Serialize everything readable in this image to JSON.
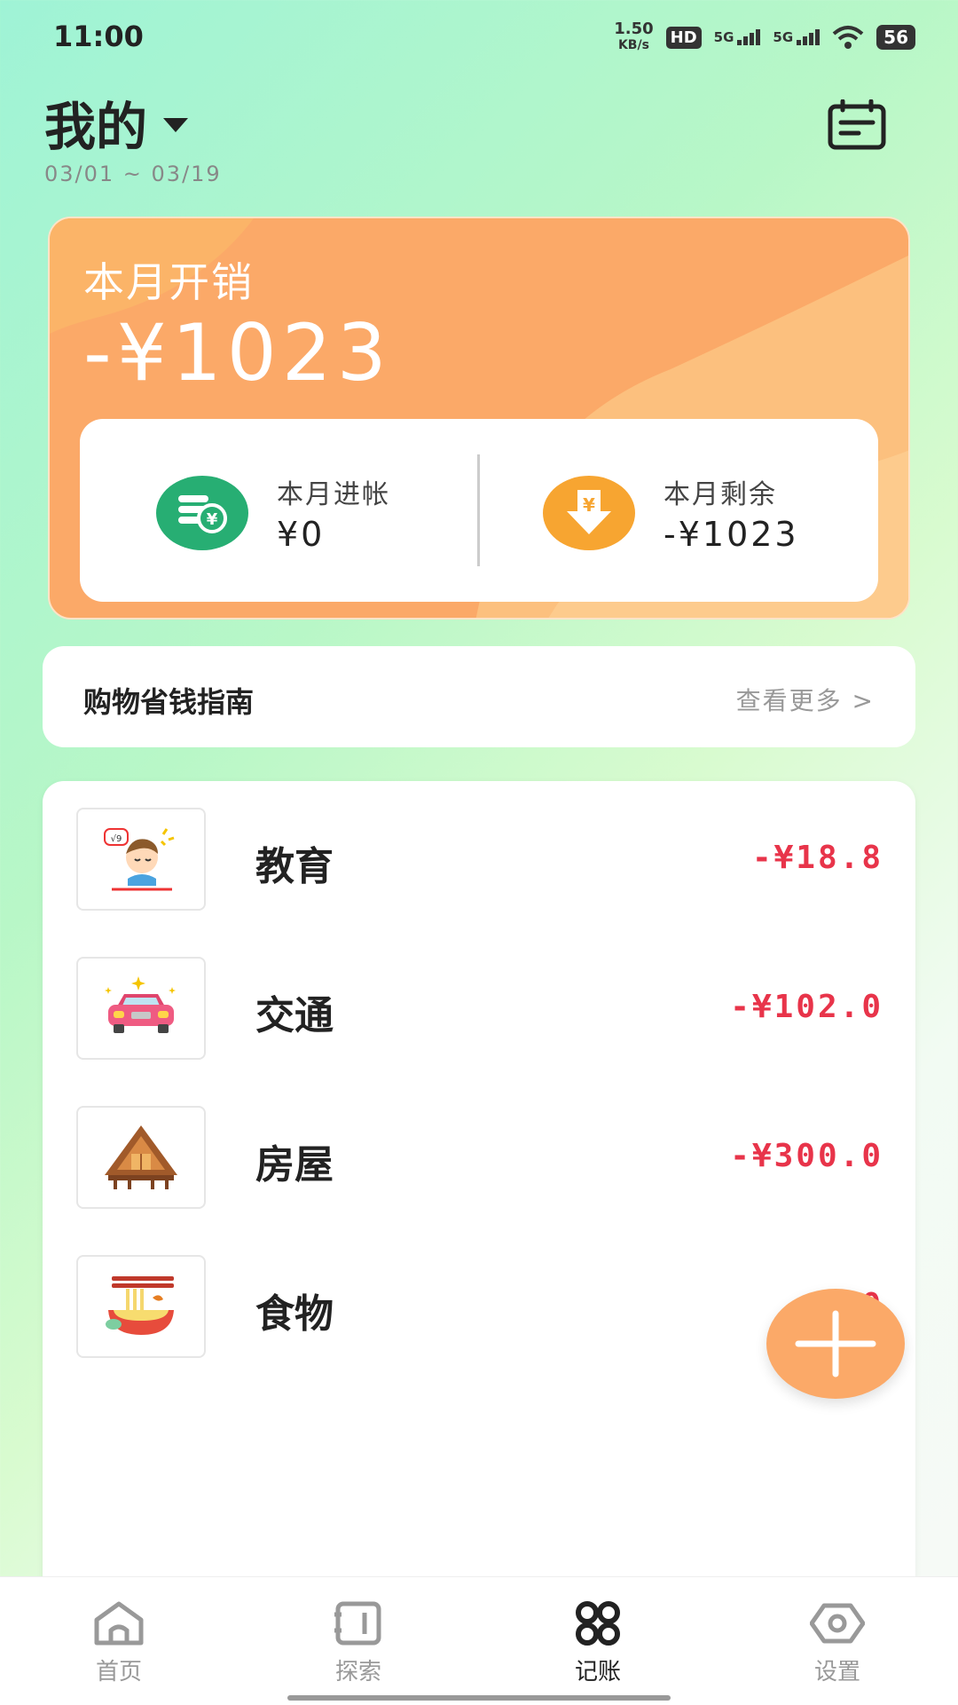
{
  "status_bar": {
    "time": "11:00",
    "net_speed_value": "1.50",
    "net_speed_unit": "KB/s",
    "hd_label": "HD",
    "sim1_label": "5G",
    "sim2_label": "5G",
    "battery": "56"
  },
  "header": {
    "title": "我的",
    "date_range": "03/01 ~ 03/19"
  },
  "spend_card": {
    "label": "本月开销",
    "amount": "-¥1023",
    "income_label": "本月进帐",
    "income_value": "¥0",
    "remain_label": "本月剩余",
    "remain_value": "-¥1023",
    "colors": {
      "card": "#fba968",
      "income_icon": "#27ae73",
      "remain_icon": "#f7a531"
    }
  },
  "guide": {
    "title": "购物省钱指南",
    "more": "查看更多 >"
  },
  "records": [
    {
      "name": "教育",
      "amount": "-¥18.8",
      "icon": "education-icon"
    },
    {
      "name": "交通",
      "amount": "-¥102.0",
      "icon": "car-icon"
    },
    {
      "name": "房屋",
      "amount": "-¥300.0",
      "icon": "house-icon"
    },
    {
      "name": "食物",
      "amount": "-¥60",
      "icon": "noodle-bowl-icon"
    }
  ],
  "tabs": [
    {
      "label": "首页",
      "icon": "home-icon"
    },
    {
      "label": "探索",
      "icon": "notebook-icon"
    },
    {
      "label": "记账",
      "icon": "grid-icon",
      "active": true
    },
    {
      "label": "设置",
      "icon": "eye-hexagon-icon"
    }
  ],
  "accent_color": "#e8344a"
}
